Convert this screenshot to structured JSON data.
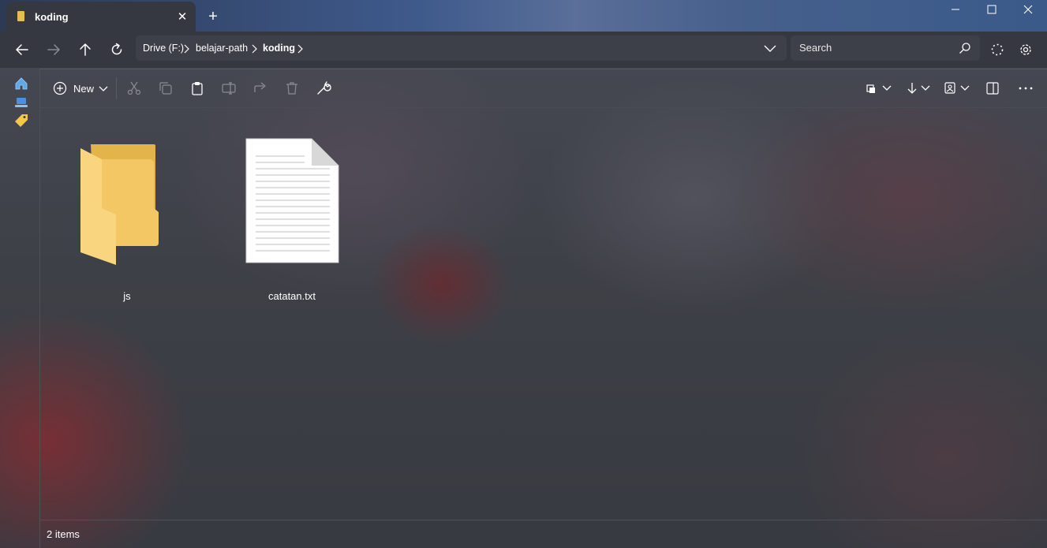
{
  "window": {
    "tab_title": "koding",
    "tab_icon": "folder-icon",
    "close_tab_glyph": "✕",
    "new_tab_glyph": "+"
  },
  "address": {
    "breadcrumbs": [
      "Drive (F:)",
      "belajar-path",
      "koding"
    ],
    "search_placeholder": "Search"
  },
  "toolbar": {
    "new_label": "New"
  },
  "items": [
    {
      "name": "js",
      "type": "folder"
    },
    {
      "name": "catatan.txt",
      "type": "text-file"
    }
  ],
  "status": {
    "item_count": "2 items"
  },
  "colors": {
    "folder": "#f2c764",
    "folder_back": "#e2b44a",
    "chrome": "#353741",
    "accent_blue": "#4a90e2"
  }
}
